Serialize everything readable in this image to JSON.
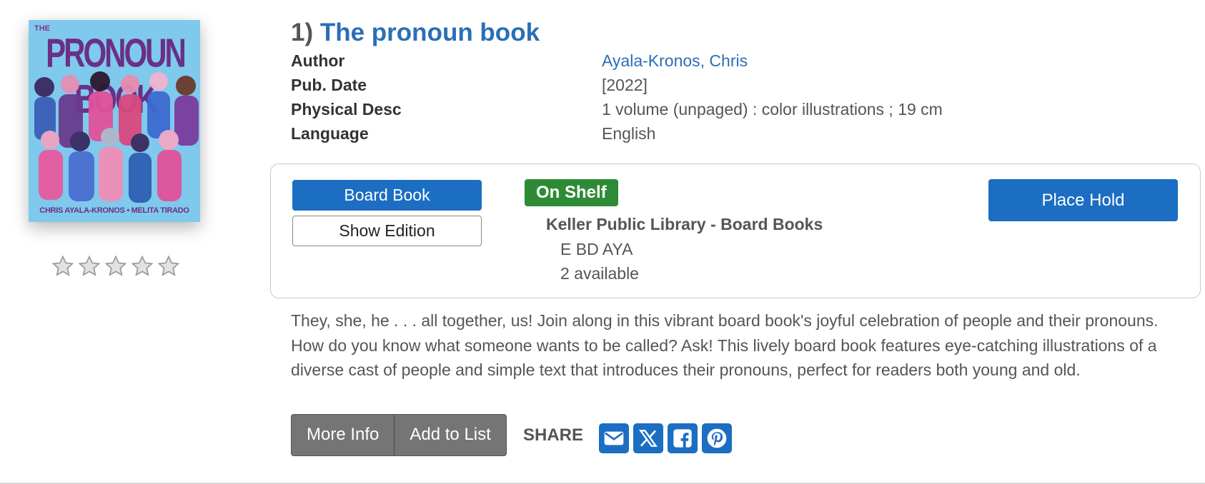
{
  "cover": {
    "top_text": "THE",
    "title": "PRONOUN BOOK",
    "authors": "CHRIS AYALA-KRONOS • MELITA TIRADO",
    "bg_color": "#7fc9ec"
  },
  "rating": {
    "stars_filled": 0,
    "stars_total": 5
  },
  "result": {
    "number": "1)",
    "title": "The pronoun book"
  },
  "details": [
    {
      "label": "Author",
      "value": "Ayala-Kronos, Chris"
    },
    {
      "label": "Pub. Date",
      "value": "[2022]"
    },
    {
      "label": "Physical Desc",
      "value": "1 volume (unpaged) : color illustrations ; 19 cm"
    },
    {
      "label": "Language",
      "value": "English"
    }
  ],
  "availability": {
    "format_label": "Board Book",
    "show_edition_label": "Show Edition",
    "status_badge": "On Shelf",
    "location": "Keller Public Library - Board Books",
    "call_number": "E BD AYA",
    "available_count": "2 available",
    "place_hold_label": "Place Hold"
  },
  "description": "They, she, he . . . all together, us! Join along in this vibrant board book's joyful celebration of people and their pronouns. How do you know what someone wants to be called? Ask! This lively board book features eye-catching illustrations of a diverse cast of people and simple text that introduces their pronouns, perfect for readers both young and old.",
  "actions": {
    "more_info_label": "More Info",
    "add_to_list_label": "Add to List",
    "share_label": "SHARE",
    "share_icons": [
      "email-icon",
      "x-twitter-icon",
      "facebook-icon",
      "pinterest-icon"
    ]
  },
  "colors": {
    "link_blue": "#2a6fb5",
    "button_blue": "#1b6ec2",
    "status_green": "#2e8b35",
    "action_gray": "#757575"
  }
}
